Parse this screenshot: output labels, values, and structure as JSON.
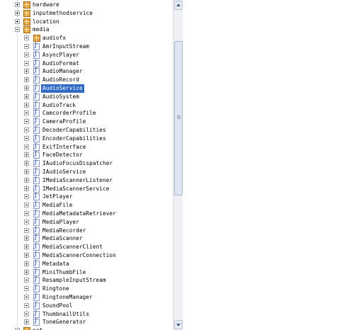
{
  "tree": {
    "top_packages": [
      {
        "name": "hardware",
        "expanded": false
      },
      {
        "name": "inputmethodservice",
        "expanded": false
      },
      {
        "name": "location",
        "expanded": false
      },
      {
        "name": "media",
        "expanded": true
      }
    ],
    "media_children": [
      {
        "name": "audiofx",
        "kind": "package"
      },
      {
        "name": "AmrInputStream",
        "kind": "class"
      },
      {
        "name": "AsyncPlayer",
        "kind": "class"
      },
      {
        "name": "AudioFormat",
        "kind": "class"
      },
      {
        "name": "AudioManager",
        "kind": "class"
      },
      {
        "name": "AudioRecord",
        "kind": "class"
      },
      {
        "name": "AudioService",
        "kind": "class",
        "selected": true
      },
      {
        "name": "AudioSystem",
        "kind": "class"
      },
      {
        "name": "AudioTrack",
        "kind": "class"
      },
      {
        "name": "CamcorderProfile",
        "kind": "class"
      },
      {
        "name": "CameraProfile",
        "kind": "class"
      },
      {
        "name": "DecoderCapabilities",
        "kind": "class"
      },
      {
        "name": "EncoderCapabilities",
        "kind": "class"
      },
      {
        "name": "ExifInterface",
        "kind": "class"
      },
      {
        "name": "FaceDetector",
        "kind": "class"
      },
      {
        "name": "IAudioFocusDispatcher",
        "kind": "class"
      },
      {
        "name": "IAudioService",
        "kind": "class"
      },
      {
        "name": "IMediaScannerListener",
        "kind": "class"
      },
      {
        "name": "IMediaScannerService",
        "kind": "class"
      },
      {
        "name": "JetPlayer",
        "kind": "class"
      },
      {
        "name": "MediaFile",
        "kind": "class"
      },
      {
        "name": "MediaMetadataRetriever",
        "kind": "class"
      },
      {
        "name": "MediaPlayer",
        "kind": "class"
      },
      {
        "name": "MediaRecorder",
        "kind": "class"
      },
      {
        "name": "MediaScanner",
        "kind": "class"
      },
      {
        "name": "MediaScannerClient",
        "kind": "class"
      },
      {
        "name": "MediaScannerConnection",
        "kind": "class"
      },
      {
        "name": "Metadata",
        "kind": "class"
      },
      {
        "name": "MiniThumbFile",
        "kind": "class"
      },
      {
        "name": "ResampleInputStream",
        "kind": "class"
      },
      {
        "name": "Ringtone",
        "kind": "class"
      },
      {
        "name": "RingtoneManager",
        "kind": "class"
      },
      {
        "name": "SoundPool",
        "kind": "class"
      },
      {
        "name": "ThumbnailUtils",
        "kind": "class"
      },
      {
        "name": "ToneGenerator",
        "kind": "class"
      }
    ],
    "class_icon_glyph": "J",
    "partial_next_package": "net"
  },
  "colors": {
    "selection": "#316ac5",
    "package_icon": "#e6a545",
    "class_icon_letter": "#2a4fb3"
  },
  "scrollbar": {
    "up_arrow_icon": "arrow-up-icon",
    "down_arrow_icon": "arrow-down-icon",
    "position_fraction": 0.2
  }
}
